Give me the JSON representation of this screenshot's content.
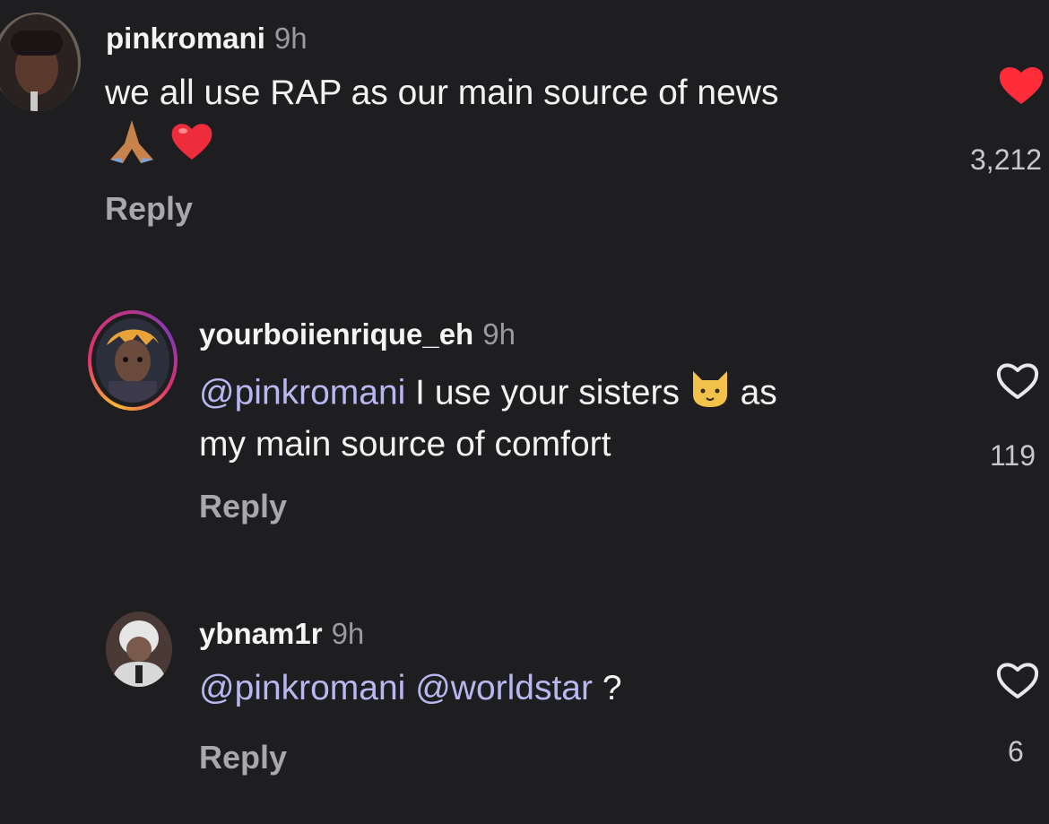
{
  "comments": [
    {
      "username": "pinkromani",
      "time": "9h",
      "text_line1": "we all use RAP as our main source of news",
      "reply_label": "Reply",
      "likes": "3,212",
      "liked": true
    },
    {
      "username": "yourboiienrique_eh",
      "time": "9h",
      "mention": "@pinkromani",
      "text_part1": " I use your sisters ",
      "text_part2": " as",
      "text_line2": "my main source of comfort",
      "reply_label": "Reply",
      "likes": "119",
      "liked": false
    },
    {
      "username": "ybnam1r",
      "time": "9h",
      "mention1": "@pinkromani",
      "mention2": "@worldstar",
      "text_tail": " ?",
      "reply_label": "Reply",
      "likes": "6",
      "liked": false
    }
  ],
  "colors": {
    "background": "#1e1e20",
    "mention": "#b9b7f0",
    "like_filled": "#ff2d3a",
    "muted": "#9a9a9e"
  },
  "icons": {
    "liked": "heart-filled-icon",
    "unliked": "heart-outline-icon",
    "emojis": [
      "folded-hands-emoji",
      "red-heart-emoji",
      "cat-face-emoji"
    ]
  }
}
